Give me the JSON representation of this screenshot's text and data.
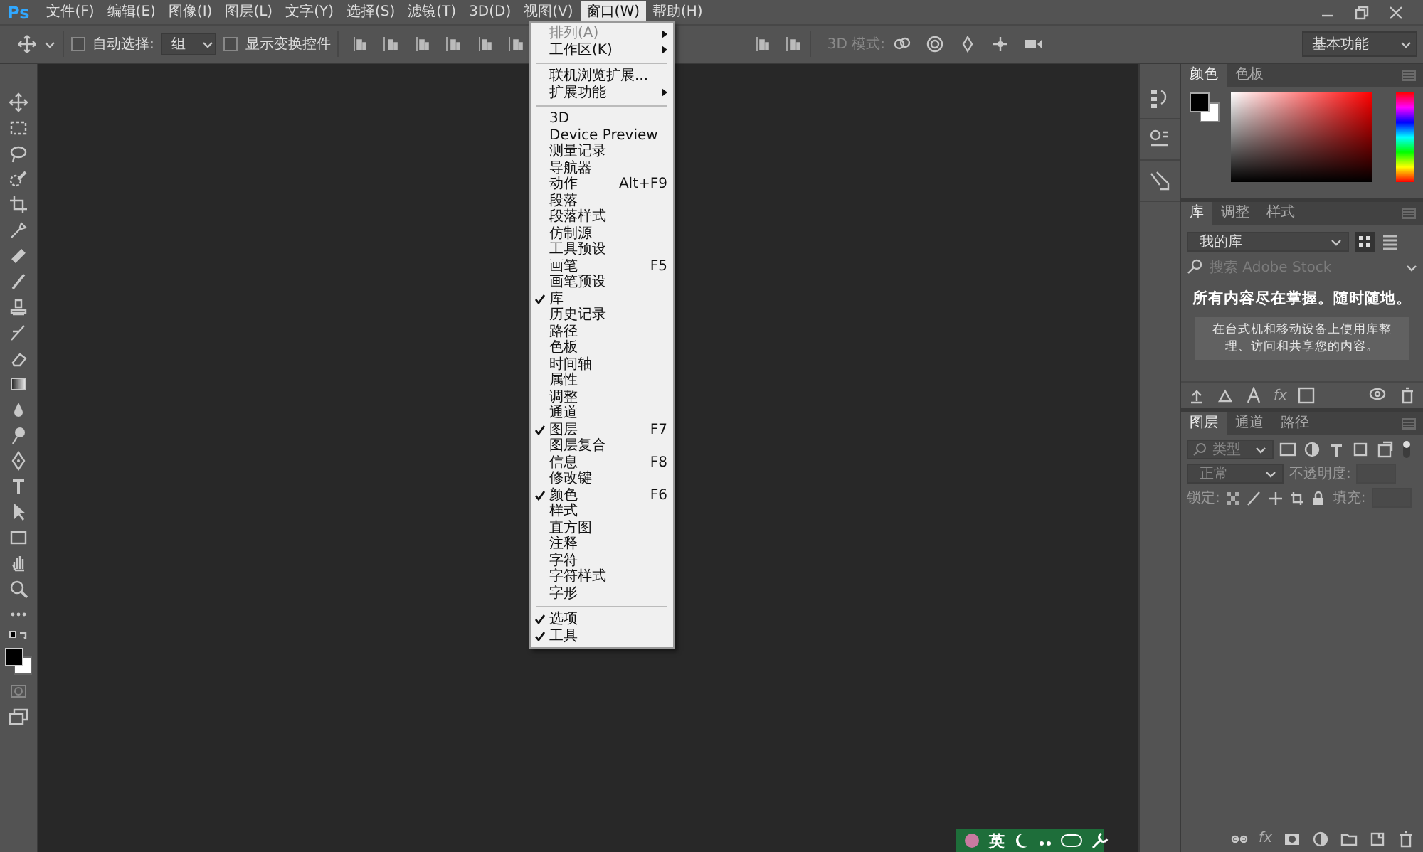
{
  "menu_bar": {
    "logo": "Ps",
    "items": [
      {
        "label": "文件(F)",
        "selected": false
      },
      {
        "label": "编辑(E)",
        "selected": false
      },
      {
        "label": "图像(I)",
        "selected": false
      },
      {
        "label": "图层(L)",
        "selected": false
      },
      {
        "label": "文字(Y)",
        "selected": false
      },
      {
        "label": "选择(S)",
        "selected": false
      },
      {
        "label": "滤镜(T)",
        "selected": false
      },
      {
        "label": "3D(D)",
        "selected": false
      },
      {
        "label": "视图(V)",
        "selected": false
      },
      {
        "label": "窗口(W)",
        "selected": true
      },
      {
        "label": "帮助(H)",
        "selected": false
      }
    ]
  },
  "options_bar": {
    "auto_select": {
      "label": "自动选择:",
      "checked": false
    },
    "auto_select_target": "组",
    "show_transform": {
      "label": "显示变换控件",
      "checked": false
    },
    "mode_3d_label": "3D 模式:",
    "workspace": "基本功能"
  },
  "window_menu": {
    "items": [
      {
        "kind": "item",
        "label": "排列(A)",
        "disabled": true,
        "submenu": true,
        "checked": false
      },
      {
        "kind": "item",
        "label": "工作区(K)",
        "disabled": false,
        "submenu": true,
        "checked": false
      },
      {
        "kind": "separator"
      },
      {
        "kind": "item",
        "label": "联机浏览扩展...",
        "disabled": false,
        "submenu": false,
        "checked": false
      },
      {
        "kind": "item",
        "label": "扩展功能",
        "disabled": false,
        "submenu": true,
        "checked": false
      },
      {
        "kind": "separator"
      },
      {
        "kind": "item",
        "label": "3D",
        "disabled": false,
        "submenu": false,
        "checked": false
      },
      {
        "kind": "item",
        "label": "Device Preview",
        "disabled": false,
        "submenu": false,
        "checked": false
      },
      {
        "kind": "item",
        "label": "测量记录",
        "disabled": false,
        "submenu": false,
        "checked": false
      },
      {
        "kind": "item",
        "label": "导航器",
        "disabled": false,
        "submenu": false,
        "checked": false
      },
      {
        "kind": "item",
        "label": "动作",
        "shortcut": "Alt+F9",
        "disabled": false,
        "submenu": false,
        "checked": false
      },
      {
        "kind": "item",
        "label": "段落",
        "disabled": false,
        "submenu": false,
        "checked": false
      },
      {
        "kind": "item",
        "label": "段落样式",
        "disabled": false,
        "submenu": false,
        "checked": false
      },
      {
        "kind": "item",
        "label": "仿制源",
        "disabled": false,
        "submenu": false,
        "checked": false
      },
      {
        "kind": "item",
        "label": "工具预设",
        "disabled": false,
        "submenu": false,
        "checked": false
      },
      {
        "kind": "item",
        "label": "画笔",
        "shortcut": "F5",
        "disabled": false,
        "submenu": false,
        "checked": false
      },
      {
        "kind": "item",
        "label": "画笔预设",
        "disabled": false,
        "submenu": false,
        "checked": false
      },
      {
        "kind": "item",
        "label": "库",
        "disabled": false,
        "submenu": false,
        "checked": true
      },
      {
        "kind": "item",
        "label": "历史记录",
        "disabled": false,
        "submenu": false,
        "checked": false
      },
      {
        "kind": "item",
        "label": "路径",
        "disabled": false,
        "submenu": false,
        "checked": false
      },
      {
        "kind": "item",
        "label": "色板",
        "disabled": false,
        "submenu": false,
        "checked": false
      },
      {
        "kind": "item",
        "label": "时间轴",
        "disabled": false,
        "submenu": false,
        "checked": false
      },
      {
        "kind": "item",
        "label": "属性",
        "disabled": false,
        "submenu": false,
        "checked": false
      },
      {
        "kind": "item",
        "label": "调整",
        "disabled": false,
        "submenu": false,
        "checked": false
      },
      {
        "kind": "item",
        "label": "通道",
        "disabled": false,
        "submenu": false,
        "checked": false
      },
      {
        "kind": "item",
        "label": "图层",
        "shortcut": "F7",
        "disabled": false,
        "submenu": false,
        "checked": true
      },
      {
        "kind": "item",
        "label": "图层复合",
        "disabled": false,
        "submenu": false,
        "checked": false
      },
      {
        "kind": "item",
        "label": "信息",
        "shortcut": "F8",
        "disabled": false,
        "submenu": false,
        "checked": false
      },
      {
        "kind": "item",
        "label": "修改键",
        "disabled": false,
        "submenu": false,
        "checked": false
      },
      {
        "kind": "item",
        "label": "颜色",
        "shortcut": "F6",
        "disabled": false,
        "submenu": false,
        "checked": true
      },
      {
        "kind": "item",
        "label": "样式",
        "disabled": false,
        "submenu": false,
        "checked": false
      },
      {
        "kind": "item",
        "label": "直方图",
        "disabled": false,
        "submenu": false,
        "checked": false
      },
      {
        "kind": "item",
        "label": "注释",
        "disabled": false,
        "submenu": false,
        "checked": false
      },
      {
        "kind": "item",
        "label": "字符",
        "disabled": false,
        "submenu": false,
        "checked": false
      },
      {
        "kind": "item",
        "label": "字符样式",
        "disabled": false,
        "submenu": false,
        "checked": false
      },
      {
        "kind": "item",
        "label": "字形",
        "disabled": false,
        "submenu": false,
        "checked": false
      },
      {
        "kind": "separator"
      },
      {
        "kind": "item",
        "label": "选项",
        "disabled": false,
        "submenu": false,
        "checked": true
      },
      {
        "kind": "item",
        "label": "工具",
        "disabled": false,
        "submenu": false,
        "checked": true
      }
    ]
  },
  "color_panel": {
    "tabs": [
      {
        "label": "颜色",
        "selected": true
      },
      {
        "label": "色板",
        "selected": false
      }
    ]
  },
  "library_panel": {
    "tabs": [
      {
        "label": "库",
        "selected": true
      },
      {
        "label": "调整",
        "selected": false
      },
      {
        "label": "样式",
        "selected": false
      }
    ],
    "library": "我的库",
    "search_placeholder": "搜索 Adobe Stock",
    "headline": "所有内容尽在掌握。随时随地。",
    "description": "在台式机和移动设备上使用库整理、访问和共享您的内容。",
    "fx_button": "fx"
  },
  "layers_panel": {
    "tabs": [
      {
        "label": "图层",
        "selected": true
      },
      {
        "label": "通道",
        "selected": false
      },
      {
        "label": "路径",
        "selected": false
      }
    ],
    "filter": "类型",
    "blend_mode": "正常",
    "opacity_label": "不透明度:",
    "lock_label": "锁定:",
    "fill_label": "填充:",
    "fx_button": "fx"
  },
  "ime_bar": {
    "language": "英"
  }
}
